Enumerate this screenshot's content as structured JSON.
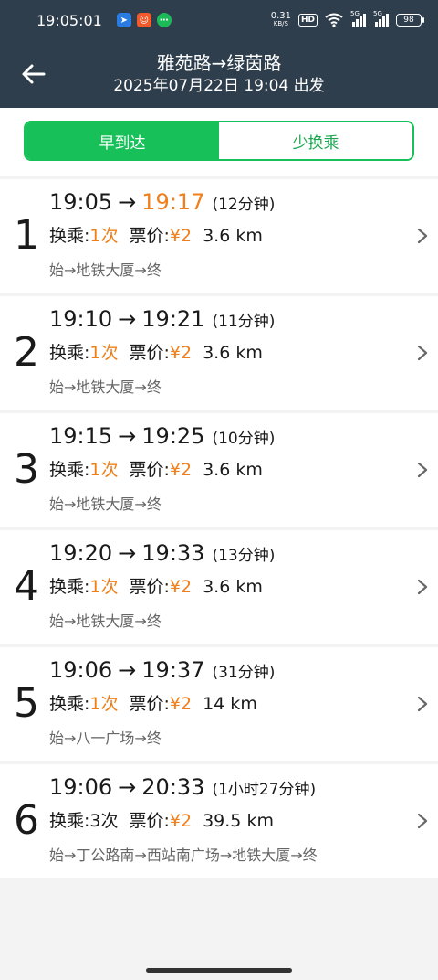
{
  "status": {
    "time": "19:05:01",
    "net_speed": "0.31",
    "net_unit": "KB/S",
    "hd": "HD",
    "sig1_label": "5G",
    "sig2_label": "5G",
    "battery": "98"
  },
  "header": {
    "title": "雅苑路→绿茵路",
    "subtitle": "2025年07月22日 19:04 出发"
  },
  "tabs": [
    {
      "label": "早到达"
    },
    {
      "label": "少换乘"
    }
  ],
  "labels": {
    "transfer": "换乘:",
    "fare": "票价:"
  },
  "routes": [
    {
      "index": "1",
      "depart": "19:05",
      "arrow": "→",
      "arrive": "19:17",
      "duration": "(12分钟)",
      "transfers": "1次",
      "fare": "¥2",
      "distance": "3.6 km",
      "path": "始→地铁大厦→终"
    },
    {
      "index": "2",
      "depart": "19:10",
      "arrow": "→",
      "arrive": "19:21",
      "duration": "(11分钟)",
      "transfers": "1次",
      "fare": "¥2",
      "distance": "3.6 km",
      "path": "始→地铁大厦→终"
    },
    {
      "index": "3",
      "depart": "19:15",
      "arrow": "→",
      "arrive": "19:25",
      "duration": "(10分钟)",
      "transfers": "1次",
      "fare": "¥2",
      "distance": "3.6 km",
      "path": "始→地铁大厦→终"
    },
    {
      "index": "4",
      "depart": "19:20",
      "arrow": "→",
      "arrive": "19:33",
      "duration": "(13分钟)",
      "transfers": "1次",
      "fare": "¥2",
      "distance": "3.6 km",
      "path": "始→地铁大厦→终"
    },
    {
      "index": "5",
      "depart": "19:06",
      "arrow": "→",
      "arrive": "19:37",
      "duration": "(31分钟)",
      "transfers": "1次",
      "fare": "¥2",
      "distance": "14 km",
      "path": "始→八一广场→终"
    },
    {
      "index": "6",
      "depart": "19:06",
      "arrow": "→",
      "arrive": "20:33",
      "duration": "(1小时27分钟)",
      "transfers": "3次",
      "fare": "¥2",
      "distance": "39.5 km",
      "path": "始→丁公路南→西站南广场→地铁大厦→终"
    }
  ],
  "colors": {
    "header_bg": "#2f3e4c",
    "accent_green": "#18c05a",
    "highlight_orange": "#f07f1a"
  }
}
